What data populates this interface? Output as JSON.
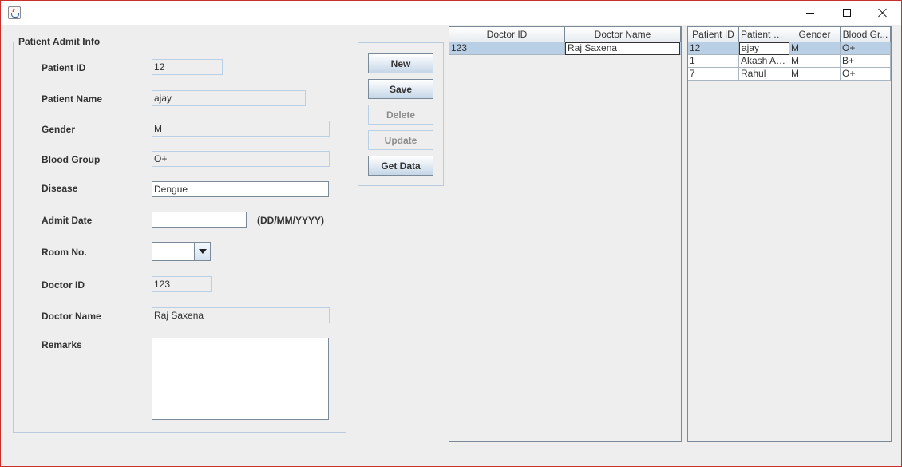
{
  "window": {
    "icon": "java-icon",
    "controls": [
      "minimize-icon",
      "maximize-icon",
      "close-icon"
    ]
  },
  "patient_form": {
    "legend": "Patient Admit Info",
    "patient_id": {
      "label": "Patient ID",
      "value": "12"
    },
    "patient_name": {
      "label": "Patient Name",
      "value": "ajay"
    },
    "gender": {
      "label": "Gender",
      "value": "M"
    },
    "blood_group": {
      "label": "Blood Group",
      "value": "O+"
    },
    "disease": {
      "label": "Disease",
      "value": "Dengue"
    },
    "admit_date": {
      "label": "Admit Date",
      "value": "",
      "hint": "(DD/MM/YYYY)"
    },
    "room_no": {
      "label": "Room No.",
      "value": ""
    },
    "doctor_id": {
      "label": "Doctor ID",
      "value": "123"
    },
    "doctor_name": {
      "label": "Doctor Name",
      "value": "Raj Saxena"
    },
    "remarks": {
      "label": "Remarks",
      "value": ""
    }
  },
  "actions": {
    "new": "New",
    "save": "Save",
    "delete": "Delete",
    "update": "Update",
    "get_data": "Get Data"
  },
  "doctor_table": {
    "columns": [
      "Doctor ID",
      "Doctor Name"
    ],
    "rows": [
      [
        "123",
        "Raj Saxena"
      ]
    ]
  },
  "patient_table": {
    "columns": [
      "Patient ID",
      "Patient N...",
      "Gender",
      "Blood Gr..."
    ],
    "rows": [
      [
        "12",
        "ajay",
        "M",
        "O+"
      ],
      [
        "1",
        "Akash Ag...",
        "M",
        "B+"
      ],
      [
        "7",
        "Rahul",
        "M",
        "O+"
      ]
    ]
  },
  "colors": {
    "selection": "#b8cfe5",
    "window_border": "#c8302c",
    "background": "#eeeeee"
  }
}
